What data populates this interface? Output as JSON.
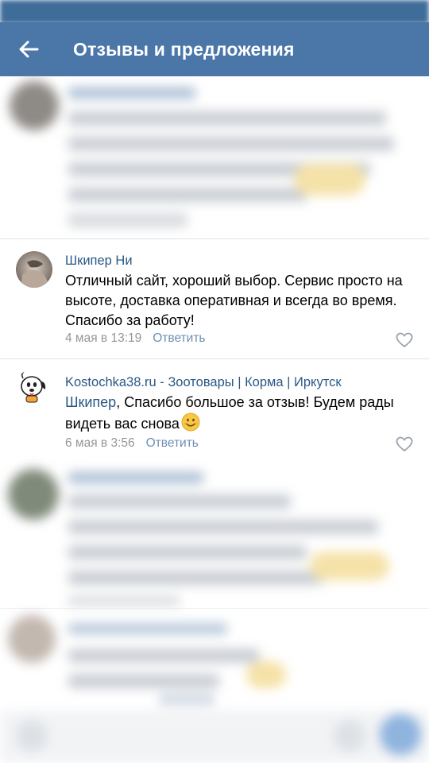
{
  "header": {
    "title": "Отзывы и предложения"
  },
  "comments": [
    {
      "author": "Шкипер Ни",
      "text": "Отличный сайт, хороший выбор. Сервис просто на высоте, доставка оперативная и всегда во время. Спасибо за работу!",
      "date": "4 мая в 13:19",
      "reply_label": "Ответить"
    },
    {
      "author": "Kostochka38.ru - Зоотовары | Корма | Иркутск",
      "reply_to": "Шкипер",
      "text": ", Спасибо большое за отзыв! Будем рады видеть вас снова",
      "date": "6 мая в 3:56",
      "reply_label": "Ответить"
    }
  ],
  "colors": {
    "header_bg": "#4a76a8",
    "link": "#2a5885",
    "meta": "#939699"
  }
}
